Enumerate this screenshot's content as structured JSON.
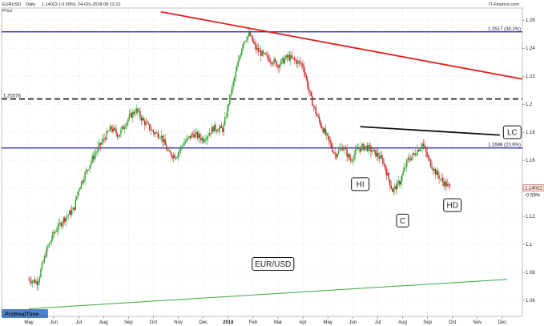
{
  "header": {
    "symbol": "EURUSD",
    "timeframe": "Daily",
    "last": "1.14022 (-0.59%)",
    "datetime": "24-Oct-2018 08:12:22",
    "source": "IT-Finance.com",
    "price_label": "Price"
  },
  "chart_data": {
    "type": "candlestick",
    "title": "EUR/USD",
    "ylim": [
      1.05,
      1.27
    ],
    "y_ticks": [
      1.06,
      1.08,
      1.1,
      1.12,
      1.14,
      1.16,
      1.18,
      1.2,
      1.22,
      1.24,
      1.26
    ],
    "y_tick_labels": [
      "1.06",
      "1.08",
      "1.1",
      "1.12",
      "1.14",
      "1.16",
      "1.18",
      "1.2",
      "1.22",
      "1.24",
      "1.26"
    ],
    "x_tick_labels": [
      "May",
      "Jun",
      "Jul",
      "Aug",
      "Sep",
      "Oct",
      "Nov",
      "Dec",
      "2018",
      "Feb",
      "Mar",
      "Apr",
      "May",
      "Jun",
      "Jul",
      "Aug",
      "Sep",
      "Oct",
      "Nov",
      "Dec"
    ],
    "last_price": {
      "value": 1.14022,
      "label": "1.14022",
      "change": "-0.59%"
    },
    "horizontal_levels": [
      {
        "value": 1.2517,
        "label": "1.2517 (38.2%)",
        "style": "solid",
        "color": "#1a1aa8"
      },
      {
        "value": 1.20378,
        "label": "1.20378",
        "style": "dashed",
        "color": "#111111"
      },
      {
        "value": 1.1688,
        "label": "1.1688 (23.6%)",
        "style": "solid",
        "color": "#1a1aa8"
      }
    ],
    "close_path": [
      {
        "m": 0.0,
        "v": 1.075
      },
      {
        "m": 0.35,
        "v": 1.073
      },
      {
        "m": 0.7,
        "v": 1.095
      },
      {
        "m": 1.0,
        "v": 1.108
      },
      {
        "m": 1.4,
        "v": 1.118
      },
      {
        "m": 1.8,
        "v": 1.125
      },
      {
        "m": 2.0,
        "v": 1.14
      },
      {
        "m": 2.3,
        "v": 1.152
      },
      {
        "m": 2.6,
        "v": 1.163
      },
      {
        "m": 3.0,
        "v": 1.175
      },
      {
        "m": 3.3,
        "v": 1.183
      },
      {
        "m": 3.6,
        "v": 1.178
      },
      {
        "m": 4.0,
        "v": 1.19
      },
      {
        "m": 4.3,
        "v": 1.196
      },
      {
        "m": 4.6,
        "v": 1.188
      },
      {
        "m": 5.0,
        "v": 1.18
      },
      {
        "m": 5.3,
        "v": 1.178
      },
      {
        "m": 5.6,
        "v": 1.165
      },
      {
        "m": 5.9,
        "v": 1.163
      },
      {
        "m": 6.2,
        "v": 1.172
      },
      {
        "m": 6.6,
        "v": 1.179
      },
      {
        "m": 7.0,
        "v": 1.175
      },
      {
        "m": 7.4,
        "v": 1.183
      },
      {
        "m": 7.8,
        "v": 1.182
      },
      {
        "m": 8.0,
        "v": 1.2
      },
      {
        "m": 8.3,
        "v": 1.222
      },
      {
        "m": 8.6,
        "v": 1.245
      },
      {
        "m": 8.85,
        "v": 1.25
      },
      {
        "m": 9.1,
        "v": 1.24
      },
      {
        "m": 9.4,
        "v": 1.235
      },
      {
        "m": 9.7,
        "v": 1.232
      },
      {
        "m": 10.0,
        "v": 1.228
      },
      {
        "m": 10.4,
        "v": 1.234
      },
      {
        "m": 10.8,
        "v": 1.23
      },
      {
        "m": 11.0,
        "v": 1.228
      },
      {
        "m": 11.3,
        "v": 1.205
      },
      {
        "m": 11.6,
        "v": 1.19
      },
      {
        "m": 12.0,
        "v": 1.175
      },
      {
        "m": 12.3,
        "v": 1.164
      },
      {
        "m": 12.6,
        "v": 1.17
      },
      {
        "m": 12.9,
        "v": 1.16
      },
      {
        "m": 13.2,
        "v": 1.168
      },
      {
        "m": 13.5,
        "v": 1.17
      },
      {
        "m": 13.9,
        "v": 1.165
      },
      {
        "m": 14.2,
        "v": 1.16
      },
      {
        "m": 14.6,
        "v": 1.138
      },
      {
        "m": 14.9,
        "v": 1.145
      },
      {
        "m": 15.2,
        "v": 1.16
      },
      {
        "m": 15.5,
        "v": 1.165
      },
      {
        "m": 15.8,
        "v": 1.172
      },
      {
        "m": 16.0,
        "v": 1.162
      },
      {
        "m": 16.3,
        "v": 1.152
      },
      {
        "m": 16.6,
        "v": 1.145
      },
      {
        "m": 16.9,
        "v": 1.14022
      }
    ],
    "trendlines": [
      {
        "name": "downtrend-resistance",
        "color": "#e02020",
        "from": {
          "m": 5.3,
          "v": 1.266
        },
        "to": {
          "m": 19.9,
          "v": 1.218
        }
      },
      {
        "name": "uptrend-support",
        "color": "#3aa83a",
        "from": {
          "m": 0.0,
          "v": 1.054
        },
        "to": {
          "m": 19.2,
          "v": 1.075
        }
      },
      {
        "name": "neckline",
        "color": "#111111",
        "from": {
          "m": 13.3,
          "v": 1.184
        },
        "to": {
          "m": 18.9,
          "v": 1.178
        }
      }
    ],
    "annotations": [
      {
        "text": "LC",
        "m": 19.4,
        "v": 1.18
      },
      {
        "text": "HI",
        "m": 13.3,
        "v": 1.143
      },
      {
        "text": "C",
        "m": 15.0,
        "v": 1.117
      },
      {
        "text": "HD",
        "m": 17.0,
        "v": 1.128
      },
      {
        "text": "EUR/USD",
        "m": 9.8,
        "v": 1.086
      }
    ],
    "grid": true,
    "up_color": "#2e9e2e",
    "down_color": "#c42020"
  },
  "footer": {
    "watermark": "ProRealTime"
  }
}
